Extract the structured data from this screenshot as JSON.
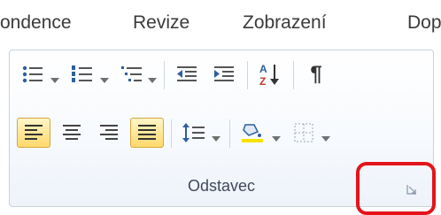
{
  "tabs": [
    {
      "label": "ondence"
    },
    {
      "label": "Revize"
    },
    {
      "label": "Zobrazení"
    },
    {
      "label": "Dop"
    }
  ],
  "group": {
    "label": "Odstavec"
  },
  "colors": {
    "highlight": "#e3141b",
    "selected_fill": "#ffd96b",
    "fill_color_bar": "#f6e200"
  },
  "icons": {
    "row1": [
      "bullets-list-icon",
      "numbering-list-icon",
      "multilevel-list-icon",
      "decrease-indent-icon",
      "increase-indent-icon",
      "sort-icon",
      "pilcrow-icon"
    ],
    "row2": [
      "align-left-icon",
      "align-center-icon",
      "align-right-icon",
      "justify-icon",
      "line-spacing-icon",
      "shading-icon",
      "borders-icon"
    ]
  },
  "toolbar": {
    "pilcrow": "¶"
  }
}
